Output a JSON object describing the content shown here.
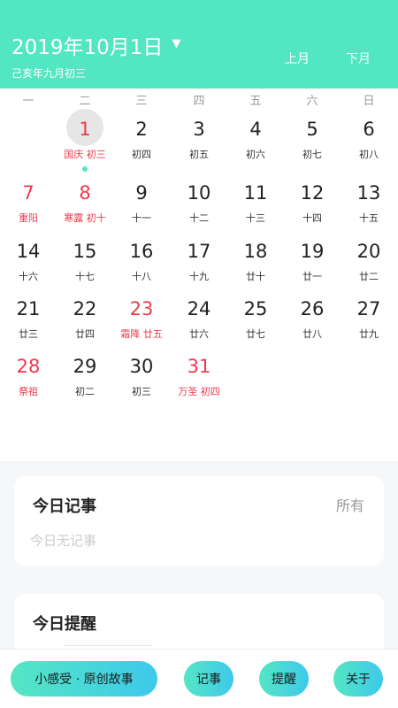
{
  "header": {
    "title": "2019年10月1日",
    "caret_icon": "▼",
    "lunar_subtitle": "己亥年九月初三",
    "prev_label": "上月",
    "next_label": "下月",
    "accent_color": "#52e6c3"
  },
  "weekdays": [
    "一",
    "二",
    "三",
    "四",
    "五",
    "六",
    "日"
  ],
  "calendar": {
    "selected_day": "1",
    "holiday_color": "#ee3a4c",
    "days": [
      {
        "day": "1",
        "sub": "国庆 初三",
        "red": true,
        "selected": true,
        "has_event": true
      },
      {
        "day": "2",
        "sub": "初四",
        "red": false
      },
      {
        "day": "3",
        "sub": "初五",
        "red": false
      },
      {
        "day": "4",
        "sub": "初六",
        "red": false
      },
      {
        "day": "5",
        "sub": "初七",
        "red": false
      },
      {
        "day": "6",
        "sub": "初八",
        "red": false
      },
      {
        "day": "7",
        "sub": "重阳",
        "red": true
      },
      {
        "day": "8",
        "sub": "寒露 初十",
        "red": true
      },
      {
        "day": "9",
        "sub": "十一",
        "red": false
      },
      {
        "day": "10",
        "sub": "十二",
        "red": false
      },
      {
        "day": "11",
        "sub": "十三",
        "red": false
      },
      {
        "day": "12",
        "sub": "十四",
        "red": false
      },
      {
        "day": "13",
        "sub": "十五",
        "red": false
      },
      {
        "day": "14",
        "sub": "十六",
        "red": false
      },
      {
        "day": "15",
        "sub": "十七",
        "red": false
      },
      {
        "day": "16",
        "sub": "十八",
        "red": false
      },
      {
        "day": "17",
        "sub": "十九",
        "red": false
      },
      {
        "day": "18",
        "sub": "廿十",
        "red": false
      },
      {
        "day": "19",
        "sub": "廿一",
        "red": false
      },
      {
        "day": "20",
        "sub": "廿二",
        "red": false
      },
      {
        "day": "21",
        "sub": "廿三",
        "red": false
      },
      {
        "day": "22",
        "sub": "廿四",
        "red": false
      },
      {
        "day": "23",
        "sub": "霜降 廿五",
        "red": true
      },
      {
        "day": "24",
        "sub": "廿六",
        "red": false
      },
      {
        "day": "25",
        "sub": "廿七",
        "red": false
      },
      {
        "day": "26",
        "sub": "廿八",
        "red": false
      },
      {
        "day": "27",
        "sub": "廿九",
        "red": false
      },
      {
        "day": "28",
        "sub": "祭祖",
        "red": true
      },
      {
        "day": "29",
        "sub": "初二",
        "red": false
      },
      {
        "day": "30",
        "sub": "初三",
        "red": false
      },
      {
        "day": "31",
        "sub": "万圣 初四",
        "red": true
      }
    ]
  },
  "notes_card": {
    "title": "今日记事",
    "all_label": "所有",
    "empty_text": "今日无记事"
  },
  "remind_card": {
    "title": "今日提醒"
  },
  "bottom_bar": {
    "story_label": "小感受 · 原创故事",
    "note_label": "记事",
    "remind_label": "提醒",
    "about_label": "关于"
  }
}
